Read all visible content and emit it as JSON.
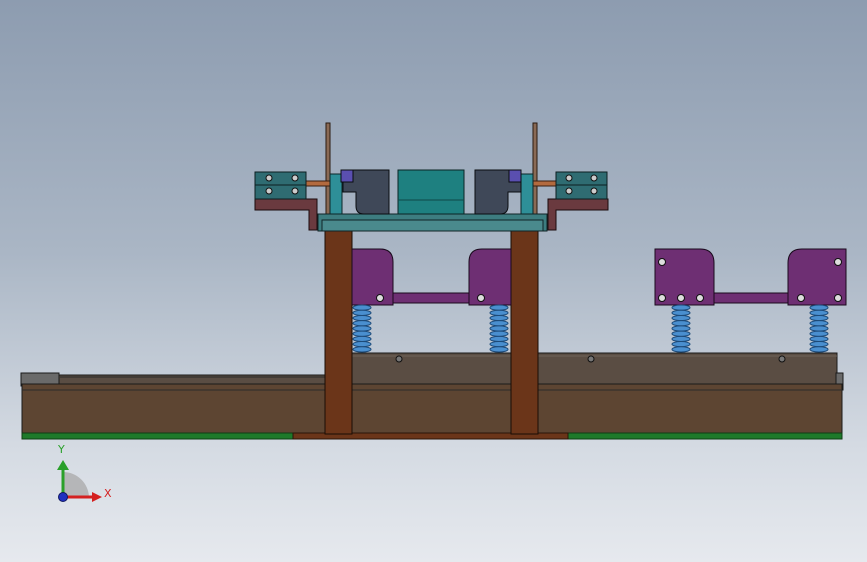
{
  "view": {
    "background_top": "#8d9cb0",
    "background_bottom": "#e6e9ee"
  },
  "triad": {
    "y_label": "Y",
    "x_label": "X",
    "y_color": "#2aa02a",
    "x_color": "#d42020",
    "z_color": "#2030c0"
  },
  "colors": {
    "base_body": "#5d4532",
    "base_rail": "#5a4d43",
    "green_strip": "#1e7a2a",
    "column": "#6b3519",
    "purple_block": "#6e2f73",
    "spring": "#4a8fcf",
    "teal_plate": "#3d7d80",
    "dark_clamp": "#3f4858",
    "teal_block": "#1e8080",
    "cyan_block": "#2e8f98",
    "maroon_plate": "#6a3a3f",
    "copper_rod": "#b36a3e"
  }
}
